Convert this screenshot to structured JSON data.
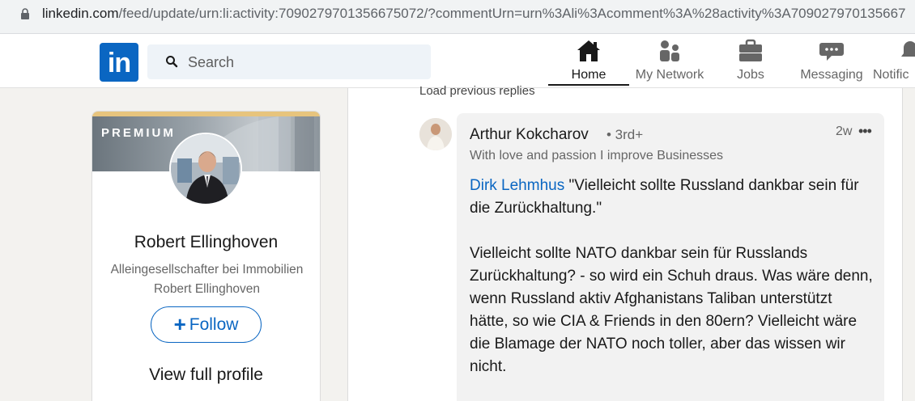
{
  "browser": {
    "url_main": "linkedin.com",
    "url_rest": "/feed/update/urn:li:activity:7090279701356675072/?commentUrn=urn%3Ali%3Acomment%3A%28activity%3A709027970135667"
  },
  "nav": {
    "logo": "in",
    "search_placeholder": "Search",
    "items": [
      {
        "label": "Home"
      },
      {
        "label": "My Network"
      },
      {
        "label": "Jobs"
      },
      {
        "label": "Messaging"
      },
      {
        "label": "Notific"
      }
    ]
  },
  "profile_card": {
    "badge": "PREMIUM",
    "name": "Robert Ellinghoven",
    "headline": "Alleingesellschafter bei Immobilien Robert Ellinghoven",
    "follow_label": "Follow",
    "view_profile_label": "View full profile"
  },
  "feed": {
    "load_previous": "Load previous replies",
    "comment": {
      "author": "Arthur Kokcharov",
      "degree": "• 3rd+",
      "age": "2w",
      "more": "•••",
      "tagline": "With love and passion I improve Businesses",
      "mention": "Dirk Lehmhus",
      "quote": " \"Vielleicht sollte Russland dankbar sein für die Zurückhaltung.\"",
      "paragraph": "Vielleicht sollte NATO dankbar sein für Russlands Zurückhaltung? - so wird ein Schuh draus. Was wäre denn, wenn Russland aktiv Afghanistans Taliban unterstützt hätte, so wie CIA & Friends in den 80ern? Vielleicht wäre die Blamage der NATO noch toller, aber das wissen wir nicht."
    }
  },
  "colors": {
    "brand": "#0a66c2",
    "premium_gold": "#e7c47d"
  }
}
